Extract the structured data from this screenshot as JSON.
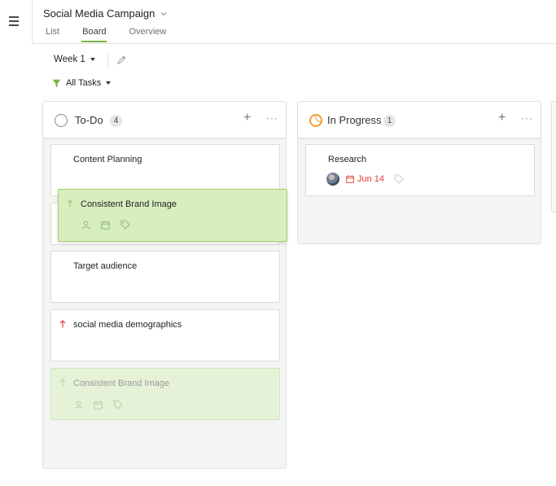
{
  "app": {
    "project_title": "Social Media Campaign",
    "tabs": [
      "List",
      "Board",
      "Overview"
    ],
    "active_tab": "Board"
  },
  "toolbar": {
    "week": "Week 1",
    "filter": "All Tasks"
  },
  "colors": {
    "accent_green": "#7cb342",
    "drag_card_bg": "#d7eebf",
    "in_progress": "#f59c33",
    "due_date_red": "#e53935"
  },
  "columns": [
    {
      "title": "To-Do",
      "count": "4",
      "status_icon": "circle-outline-icon",
      "cards": [
        {
          "title": "Content Planning"
        },
        {
          "title": "Consistent Brand Image",
          "state": "dragging"
        },
        {
          "title": "Target audience"
        },
        {
          "title": "social media demographics",
          "priority_icon": "arrow-up-icon"
        },
        {
          "title": "Consistent Brand Image",
          "state": "drop-placeholder"
        }
      ]
    },
    {
      "title": "In Progress",
      "count": "1",
      "status_icon": "half-circle-progress-icon",
      "cards": [
        {
          "title": "Research",
          "due": "Jun 14",
          "has_avatar": true
        }
      ]
    }
  ]
}
